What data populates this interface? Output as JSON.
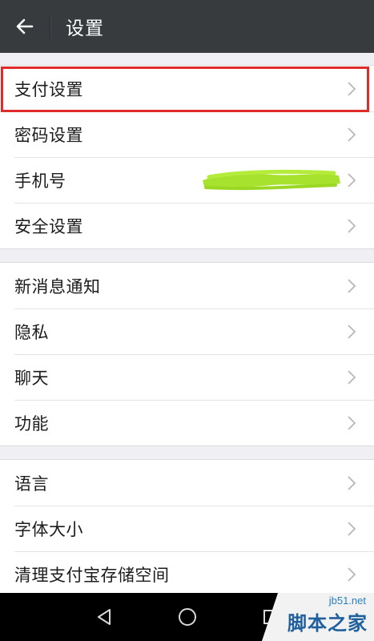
{
  "header": {
    "title": "设置",
    "back_icon": "arrow-left-icon"
  },
  "groups": [
    {
      "items": [
        {
          "label": "支付设置",
          "highlighted": true
        },
        {
          "label": "密码设置"
        },
        {
          "label": "手机号",
          "value_redacted": true
        },
        {
          "label": "安全设置"
        }
      ]
    },
    {
      "items": [
        {
          "label": "新消息通知"
        },
        {
          "label": "隐私"
        },
        {
          "label": "聊天"
        },
        {
          "label": "功能"
        }
      ]
    },
    {
      "items": [
        {
          "label": "语言"
        },
        {
          "label": "字体大小"
        },
        {
          "label": "清理支付宝存储空间"
        }
      ]
    }
  ],
  "navbar": {
    "buttons": [
      "back-triangle-icon",
      "home-circle-icon",
      "recents-square-icon"
    ]
  },
  "watermark": {
    "url": "jb51.net",
    "name": "脚本之家"
  },
  "colors": {
    "topbar": "#373b3e",
    "highlight": "#e02b2b",
    "redaction": "#a6e22e",
    "background": "#efeff4"
  }
}
